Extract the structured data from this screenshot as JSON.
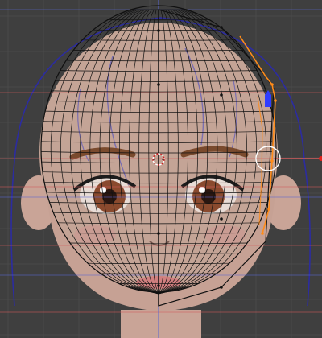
{
  "viewport": {
    "mode": "edit-mode",
    "background": "#3f3f3f",
    "grid_color": "#4a4a4a",
    "guide_red": "#d05a5a",
    "guide_blue": "#5a66d0",
    "outline_color": "#2c2ca0",
    "mesh_color": "#111111",
    "selected_color": "#ff8c1a",
    "skin_color": "#c9a497",
    "skin_under": "#dcc0b6",
    "hair_color": "#3a3a3a",
    "brow_color": "#7a4a2d",
    "iris_color": "#8a4a2e",
    "lip_color": "#d07f7f",
    "cursor_color": "#ffffff"
  },
  "status_text": ""
}
